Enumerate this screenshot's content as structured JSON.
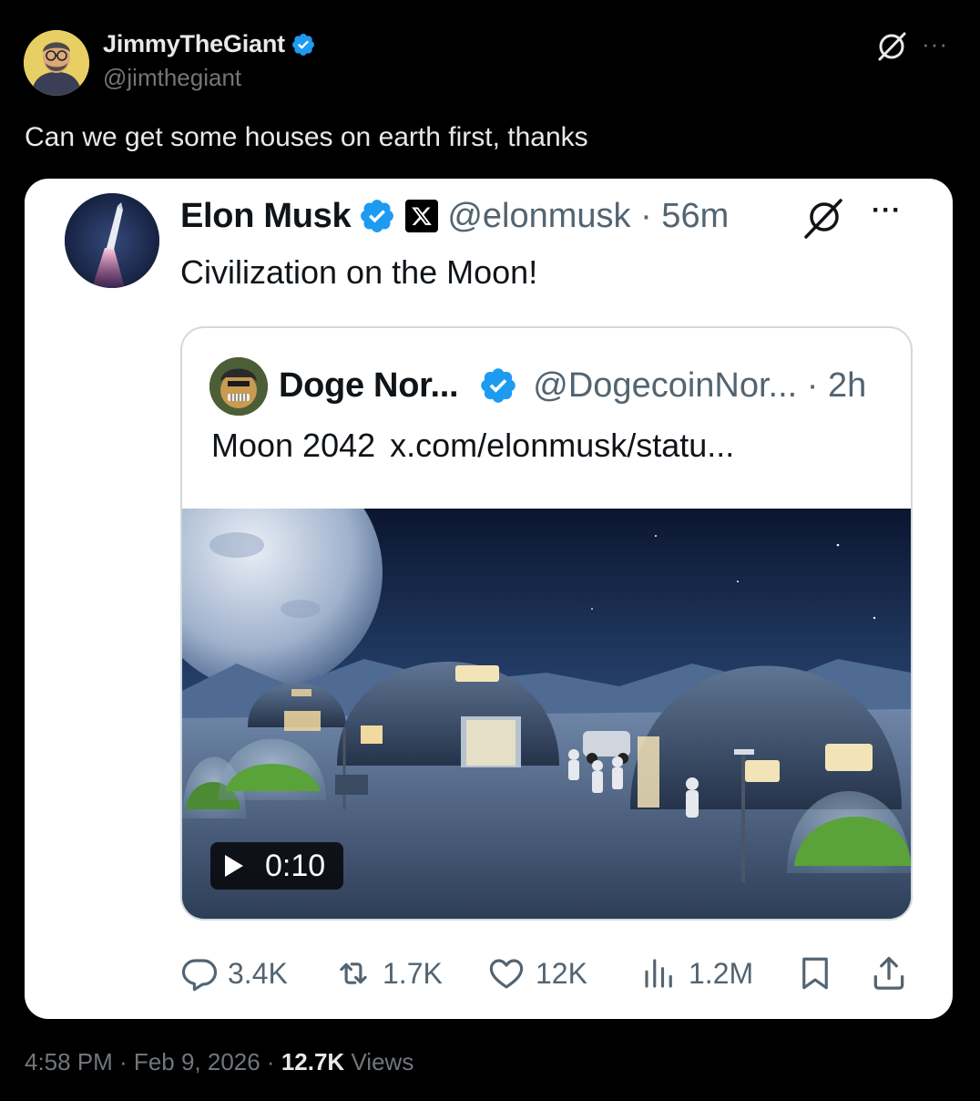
{
  "outer_tweet": {
    "display_name": "JimmyTheGiant",
    "handle": "@jimthegiant",
    "text": "Can we get some houses on earth first, thanks",
    "verified": true
  },
  "quoted_tweet": {
    "display_name": "Elon Musk",
    "handle_and_time": "@elonmusk · 56m",
    "text": "Civilization on the Moon!",
    "verified": true,
    "affiliate_badge_icon": "x-logo-icon"
  },
  "nested_quote": {
    "display_name": "Doge Nor...",
    "handle_and_time": "@DogecoinNor... · 2h",
    "text": "Moon 2042",
    "link": "x.com/elonmusk/statu...",
    "verified": true,
    "video": {
      "duration": "0:10",
      "description_icon": "play-icon"
    }
  },
  "actions": {
    "replies": "3.4K",
    "reposts": "1.7K",
    "likes": "12K",
    "views": "1.2M"
  },
  "footer": {
    "time_date": "4:58 PM · Feb 9, 2026 · ",
    "views_count": "12.7K",
    "views_label": "Views"
  },
  "colors": {
    "background": "#000000",
    "card": "#ffffff",
    "verified_blue": "#1d9bf0",
    "muted_text": "#71767b",
    "card_muted": "#536471"
  }
}
